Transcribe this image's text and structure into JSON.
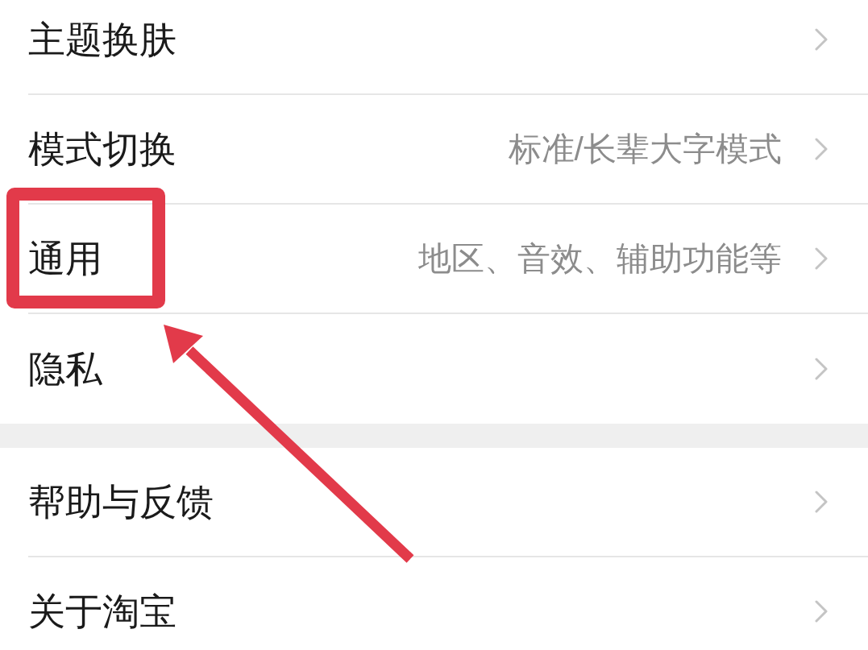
{
  "sections": [
    {
      "rows": [
        {
          "label": "主题换肤",
          "highlighted": false
        },
        {
          "label": "模式切换",
          "value": "标准/长辈大字模式",
          "highlighted": false
        },
        {
          "label": "通用",
          "value": "地区、音效、辅助功能等",
          "highlighted": true
        },
        {
          "label": "隐私",
          "highlighted": false
        }
      ]
    },
    {
      "rows": [
        {
          "label": "帮助与反馈",
          "highlighted": false
        },
        {
          "label": "关于淘宝",
          "highlighted": false
        }
      ]
    }
  ]
}
